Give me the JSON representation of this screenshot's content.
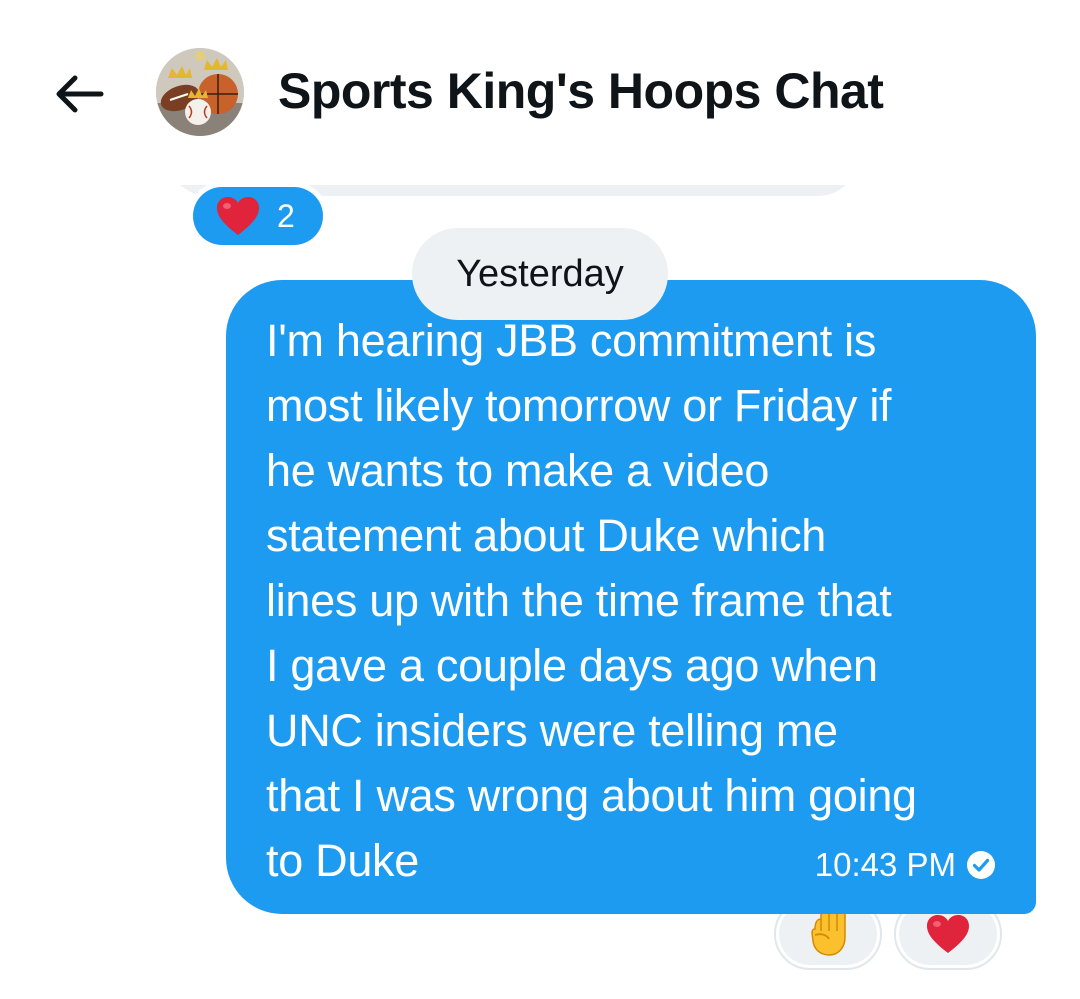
{
  "header": {
    "back_icon": "arrow-left-icon",
    "avatar_icon": "group-avatar-image",
    "title": "Sports King's Hoops Chat"
  },
  "previous_message": {
    "reaction": {
      "emoji": "heart-icon",
      "count": "2",
      "color": "#1d9bf0"
    }
  },
  "date_separator": {
    "label": "Yesterday"
  },
  "message": {
    "text": "I'm hearing JBB commitment is most likely tomorrow or Friday if he wants to make a video statement about Duke which lines up with the time frame that I gave a couple days ago when UNC insiders were telling me that I was wrong about him going to Duke",
    "lines": [
      "I'm hearing JBB commitment is",
      "most likely tomorrow or Friday if",
      "he wants to make a video",
      "statement about Duke which",
      "lines up with the time frame that",
      "I gave a couple days ago when",
      "UNC insiders were telling me",
      "that I was wrong about him going",
      "to Duke"
    ],
    "time": "10:43 PM",
    "status_icon": "read-check-icon",
    "bubble_color": "#1d9bf0",
    "reactions": [
      {
        "emoji": "raised-fist-icon"
      },
      {
        "emoji": "heart-icon"
      }
    ]
  }
}
